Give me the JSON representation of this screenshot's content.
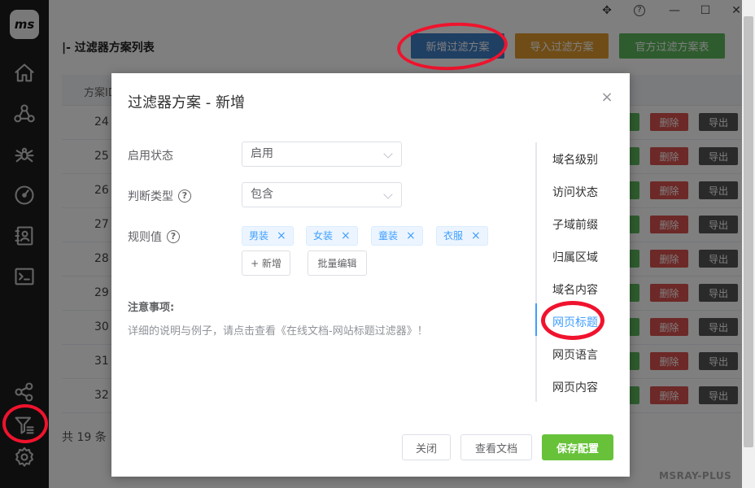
{
  "app": {
    "logo_text": "ms",
    "brand": "MSRAY-PLUS"
  },
  "window": {
    "move": "✥",
    "help": "?",
    "minimize": "—",
    "maximize": "☐",
    "close": "✕"
  },
  "page": {
    "title": "|- 过滤器方案列表"
  },
  "toolbar": {
    "add_label": "新增过滤方案",
    "import_label": "导入过滤方案",
    "official_label": "官方过滤方案表"
  },
  "colors": {
    "primary": "#3f7fc7",
    "orange": "#e09a2e",
    "green": "#5cb85c",
    "danger": "#d9534f",
    "gray": "#555",
    "modal_green": "#67c23a",
    "active_blue": "#409eff",
    "sidebar_bg": "#1d1d1d"
  },
  "table": {
    "header_col": "方案ID",
    "rows": [
      {
        "id": "24",
        "delete": "删除",
        "export": "导出"
      },
      {
        "id": "25",
        "delete": "删除",
        "export": "导出"
      },
      {
        "id": "26",
        "delete": "删除",
        "export": "导出"
      },
      {
        "id": "27",
        "delete": "删除",
        "export": "导出"
      },
      {
        "id": "28",
        "delete": "删除",
        "export": "导出"
      },
      {
        "id": "29",
        "delete": "删除",
        "export": "导出"
      },
      {
        "id": "30",
        "delete": "删除",
        "export": "导出"
      },
      {
        "id": "31",
        "delete": "删除",
        "export": "导出"
      },
      {
        "id": "32",
        "delete": "删除",
        "export": "导出"
      }
    ]
  },
  "footer": {
    "count": "共 19 条"
  },
  "modal": {
    "title": "过滤器方案 - 新增",
    "close": "×",
    "enable_label": "启用状态",
    "enable_value": "启用",
    "judge_label": "判断类型",
    "judge_value": "包含",
    "rule_label": "规则值",
    "help_icon": "?",
    "tags": [
      {
        "text": "男装",
        "x": "×"
      },
      {
        "text": "女装",
        "x": "×"
      },
      {
        "text": "童装",
        "x": "×"
      },
      {
        "text": "衣服",
        "x": "×"
      }
    ],
    "add_btn": "+ 新增",
    "batch_btn": "批量编辑",
    "note_title": "注意事项:",
    "note_text": "详细的说明与例子，请点击查看《在线文档-网站标题过滤器》！",
    "nav": [
      "域名级别",
      "访问状态",
      "子域前缀",
      "归属区域",
      "域名内容",
      "网页标题",
      "网页语言",
      "网页内容"
    ],
    "active_nav": "网页标题",
    "close_btn": "关闭",
    "docs_btn": "查看文档",
    "save_btn": "保存配置"
  }
}
